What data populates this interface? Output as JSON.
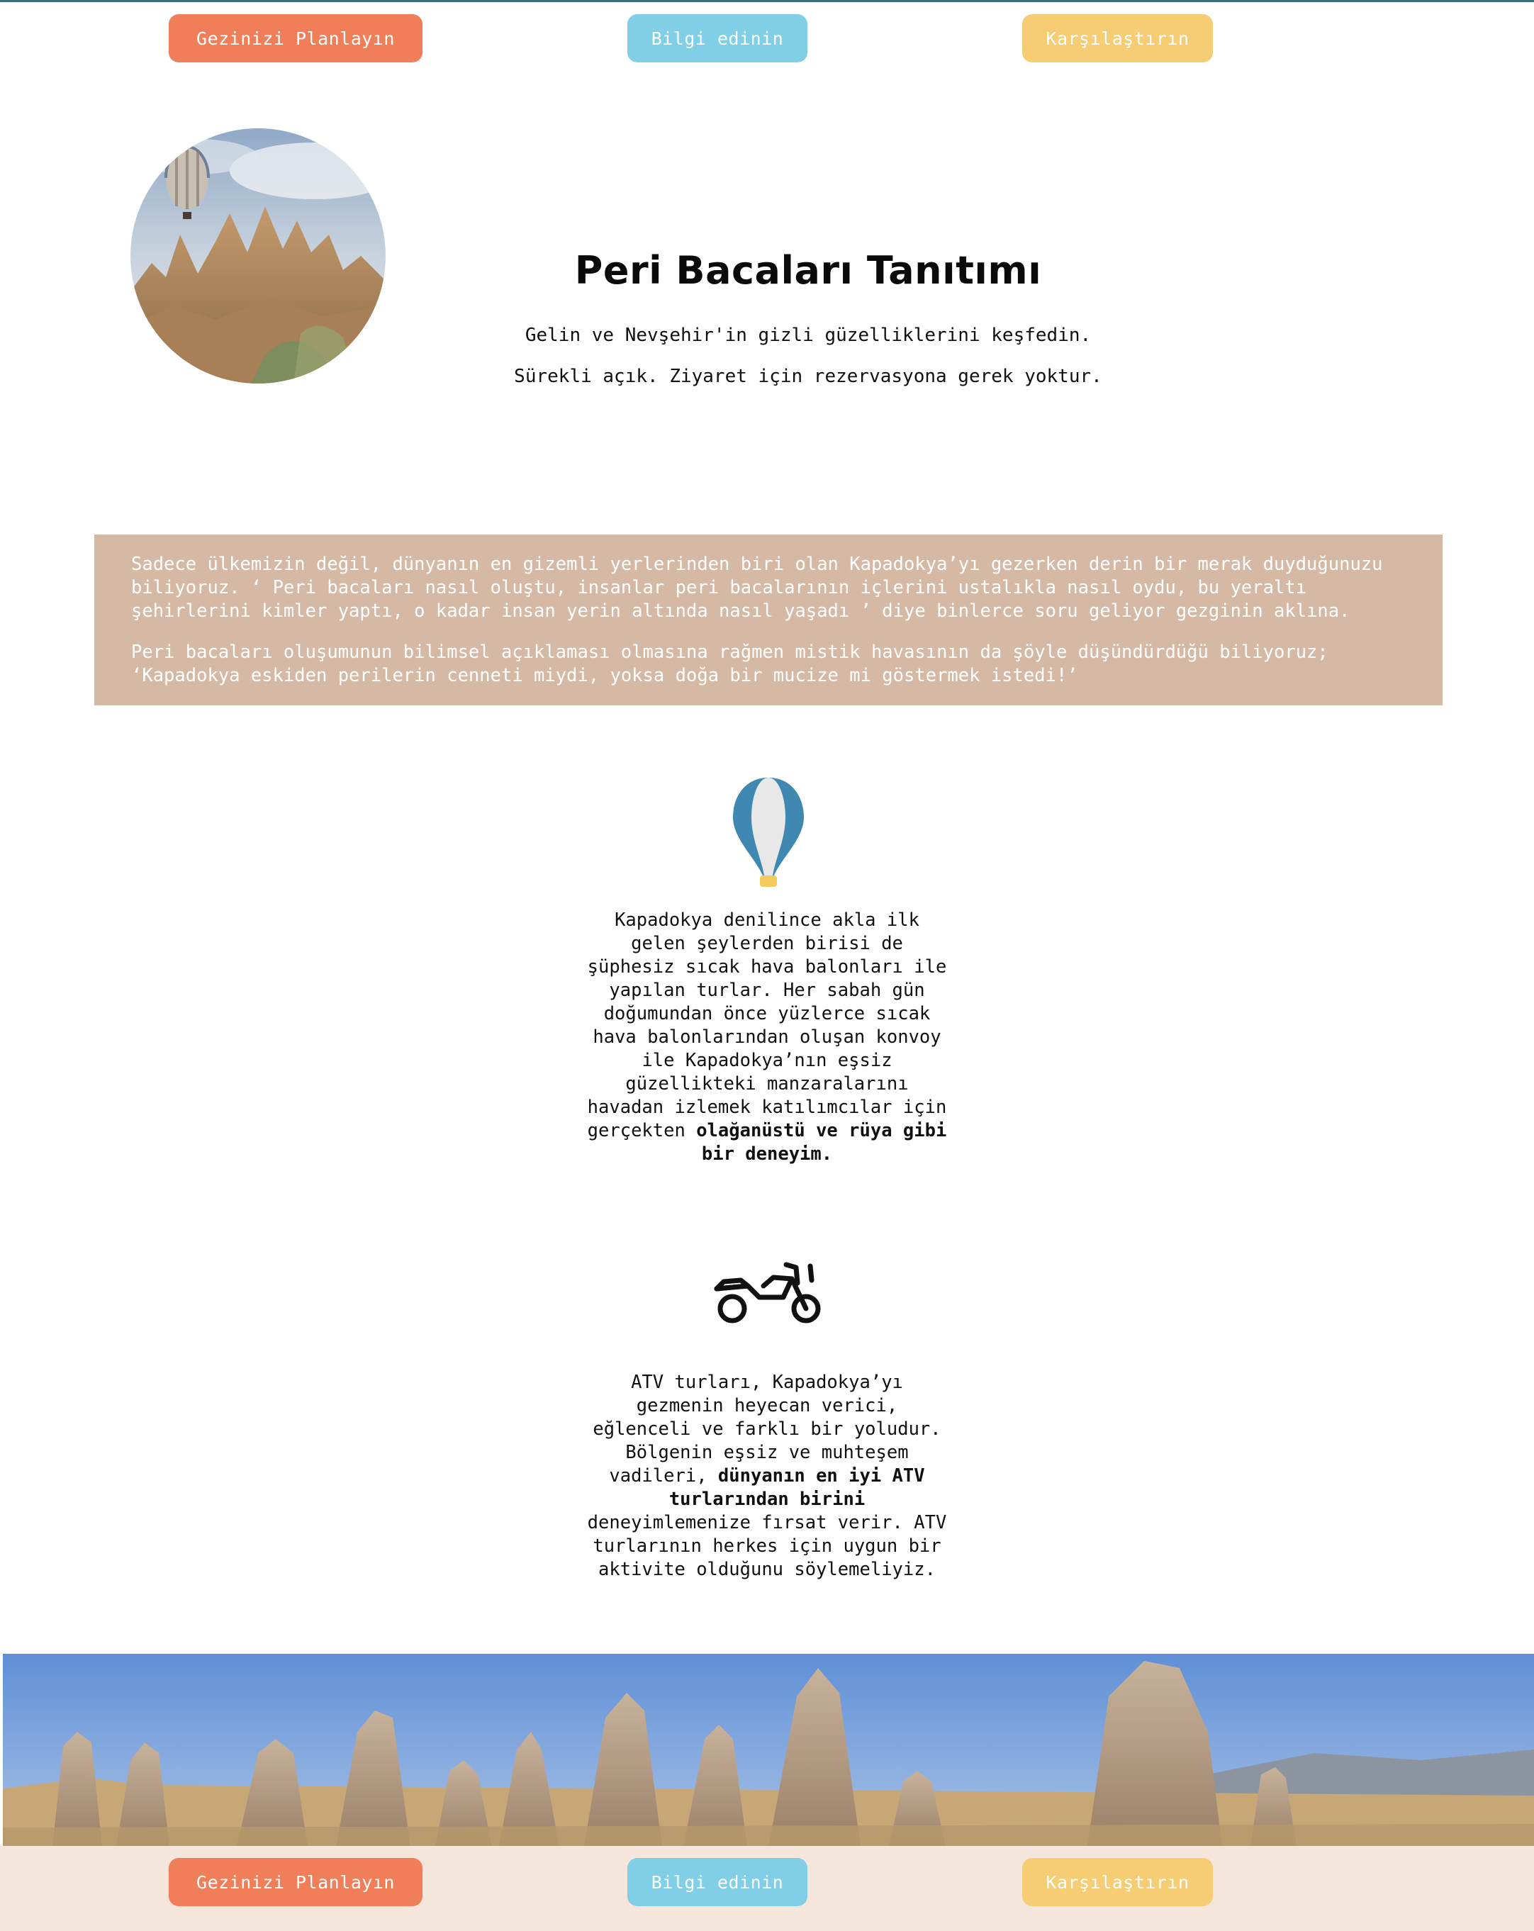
{
  "nav": {
    "plan_label": "Gezinizi Planlayın",
    "info_label": "Bilgi edinin",
    "compare_label": "Karşılaştırın"
  },
  "hero": {
    "title": "Peri Bacaları Tanıtımı",
    "subtitle_1": "Gelin ve Nevşehir'in gizli güzelliklerini keşfedin.",
    "subtitle_2": "Sürekli açık. Ziyaret için rezervasyona gerek yoktur."
  },
  "intro": {
    "paragraph_1": "Sadece ülkemizin değil, dünyanın en gizemli yerlerinden biri olan Kapadokya’yı gezerken derin bir merak duyduğunuzu biliyoruz. ‘ Peri bacaları nasıl oluştu, insanlar peri bacalarının içlerini ustalıkla nasıl oydu, bu yeraltı şehirlerini kimler yaptı, o kadar insan yerin altında nasıl yaşadı ’ diye binlerce soru geliyor gezginin aklına.",
    "paragraph_2": "Peri bacaları oluşumunun bilimsel açıklaması olmasına rağmen mistik havasının da şöyle düşündürdüğü biliyoruz; ‘Kapadokya eskiden perilerin cenneti miydi, yoksa doğa bir mucize mi göstermek istedi!’"
  },
  "features": {
    "balloon": {
      "icon": "hot-air-balloon-icon",
      "text_plain": "Kapadokya denilince akla ilk gelen şeylerden birisi de şüphesiz sıcak hava balonları ile yapılan turlar. Her sabah gün doğumundan önce yüzlerce sıcak hava balonlarından oluşan konvoy ile Kapadokya’nın eşsiz güzellikteki manzaralarını havadan izlemek katılımcılar için gerçekten ",
      "text_bold": "olağanüstü ve rüya gibi bir deneyim."
    },
    "atv": {
      "icon": "motorcycle-icon",
      "text_plain_1": "ATV turları, Kapadokya’yı gezmenin heyecan verici, eğlenceli ve farklı bir yoludur. Bölgenin eşsiz ve muhteşem vadileri, ",
      "text_bold": "dünyanın en iyi ATV turlarından birini",
      "text_plain_2": " deneyimlemenize fırsat verir. ATV turlarının herkes için uygun bir aktivite olduğunu söylemeliyiz."
    }
  },
  "colors": {
    "plan_button": "#ef7e59",
    "info_button": "#80cfe6",
    "compare_button": "#f6cc74",
    "info_box": "#d6b9a5",
    "footer": "#f5e6dc",
    "balloon_blue": "#3f88b1"
  }
}
